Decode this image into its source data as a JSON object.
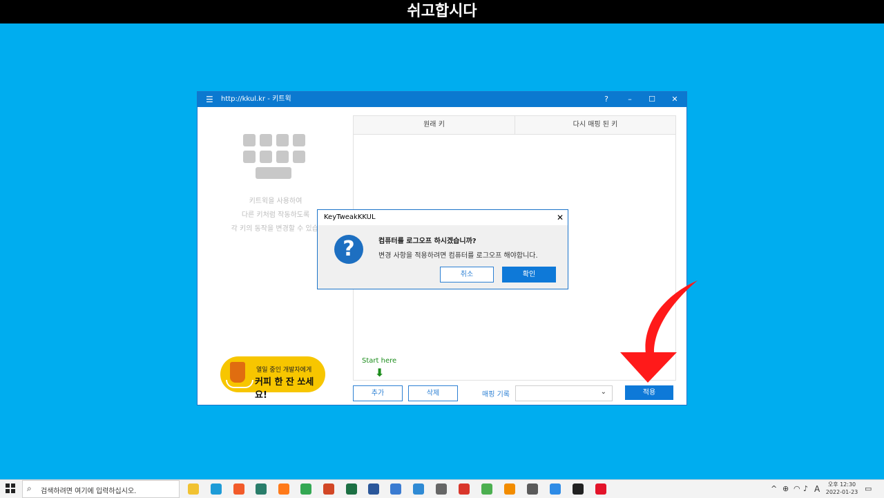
{
  "banner": {
    "text": "쉬고합시다"
  },
  "app": {
    "title": "http://kkul.kr -   키트윅",
    "help": "?",
    "minimize": "–",
    "maximize": "☐",
    "close": "✕",
    "desc_lines": [
      "키트윅을 사용하여",
      "다른 키처럼 작동하도록",
      "각 키의 동작을 변경할 수 있습니다"
    ],
    "coffee": {
      "line1": "열일 중인 개발자에게",
      "line2": "커피 한 잔 쏘세요!"
    },
    "table": {
      "col1": "원래 키",
      "col2": "다시 매핑 된 키"
    },
    "start_here": "Start here",
    "buttons": {
      "add": "추가",
      "delete": "삭제",
      "apply": "적용"
    },
    "mapping_label": "매핑 기록",
    "mapping_value": ""
  },
  "dialog": {
    "title": "KeyTweakKKUL",
    "close": "✕",
    "question": "컴퓨터를 로그오프 하시겠습니까?",
    "message": "변경 사항을 적용하려면 컴퓨터를 로그오프 해야합니다.",
    "cancel": "취소",
    "ok": "확인"
  },
  "taskbar": {
    "search_placeholder": "검색하려면 여기에 입력하십시오.",
    "ime": "A",
    "time": "오후 12:30",
    "date": "2022-01-23",
    "icons": [
      {
        "name": "file-explorer-icon",
        "color": "#f1c232"
      },
      {
        "name": "edge-icon",
        "color": "#1e9bd7"
      },
      {
        "name": "brave-icon",
        "color": "#f25b2a"
      },
      {
        "name": "edge-dev-icon",
        "color": "#2a7d6a"
      },
      {
        "name": "firefox-icon",
        "color": "#ff7a1a"
      },
      {
        "name": "chrome-icon",
        "color": "#34a853"
      },
      {
        "name": "powerpoint-icon",
        "color": "#d24726"
      },
      {
        "name": "excel-icon",
        "color": "#1d7044"
      },
      {
        "name": "word-icon",
        "color": "#2b579a"
      },
      {
        "name": "app-window-icon",
        "color": "#3b7bd1"
      },
      {
        "name": "remote-desktop-icon",
        "color": "#2f8ad4"
      },
      {
        "name": "search-tool-icon",
        "color": "#666666"
      },
      {
        "name": "se-app-icon",
        "color": "#d9362b"
      },
      {
        "name": "android-app-icon",
        "color": "#4caf50"
      },
      {
        "name": "vlc-icon",
        "color": "#f28c00"
      },
      {
        "name": "calculator-icon",
        "color": "#5a5a5a"
      },
      {
        "name": "chrome-dev-icon",
        "color": "#2e8be6"
      },
      {
        "name": "sticky-app-icon",
        "color": "#222222"
      },
      {
        "name": "opera-icon",
        "color": "#e3142a"
      }
    ]
  }
}
